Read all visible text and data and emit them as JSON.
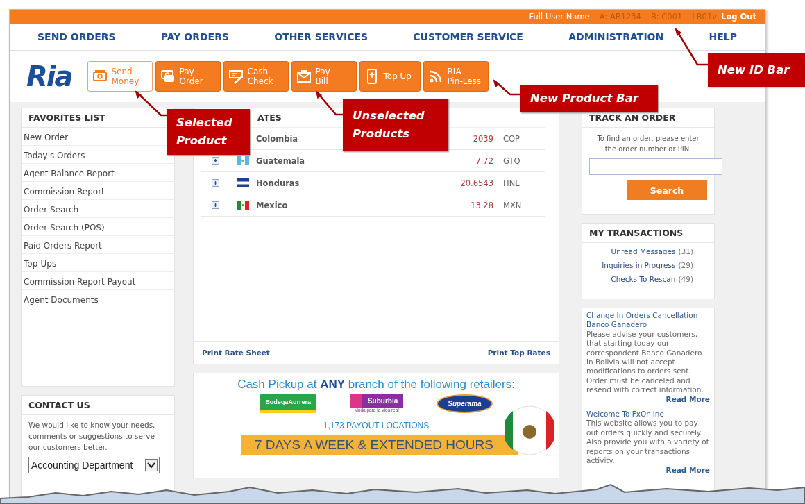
{
  "id_bar": {
    "user_name": "Full User Name",
    "ids": [
      "A: AB1234",
      "B: C001",
      "LB01v"
    ],
    "logout": "Log Out"
  },
  "nav": [
    "SEND ORDERS",
    "PAY ORDERS",
    "OTHER SERVICES",
    "CUSTOMER SERVICE",
    "ADMINISTRATION",
    "HELP"
  ],
  "logo": "Ria",
  "products": [
    {
      "lines": [
        "Send",
        "Money"
      ],
      "kind": "send",
      "selected": true
    },
    {
      "lines": [
        "Pay",
        "Order"
      ],
      "kind": "pay",
      "selected": false
    },
    {
      "lines": [
        "Cash",
        "Check"
      ],
      "kind": "check",
      "selected": false
    },
    {
      "lines": [
        "Pay",
        "Bill"
      ],
      "kind": "bill",
      "selected": false
    },
    {
      "lines": [
        "Top Up"
      ],
      "kind": "phone",
      "selected": false
    },
    {
      "lines": [
        "RIA",
        "Pin-Less"
      ],
      "kind": "signal",
      "selected": false
    }
  ],
  "favorites": {
    "title": "FAVORITES LIST",
    "items": [
      "New Order",
      "Today's Orders",
      "Agent Balance Report",
      "Commission Report",
      "Order Search",
      "Order Search (POS)",
      "Paid Orders Report",
      "Top-Ups",
      "Commission Report Payout",
      "Agent Documents"
    ]
  },
  "contact": {
    "title": "CONTACT US",
    "text": "We would like to know your needs, comments or suggestions to serve our customers better.",
    "select": "Accounting Department"
  },
  "rates": {
    "title": "ATES",
    "rows": [
      {
        "country": "Colombia",
        "rate": "2039",
        "currency": "COP",
        "kind": "covered"
      },
      {
        "country": "Guatemala",
        "rate": "7.72",
        "currency": "GTQ",
        "kind": "guatemala"
      },
      {
        "country": "Honduras",
        "rate": "20.6543",
        "currency": "HNL",
        "kind": "honduras"
      },
      {
        "country": "Mexico",
        "rate": "13.28",
        "currency": "MXN",
        "kind": "mexico"
      }
    ],
    "links": [
      "Print Rate Sheet",
      "Print Top Rates"
    ]
  },
  "banner": {
    "headline": "Cash Pickup at **ANY** branch of the following retailers:",
    "logos": [
      {
        "kind": "bodega",
        "text": "BodegaAurrera"
      },
      {
        "kind": "suburbia",
        "text": "Suburbia",
        "tagline": "Moda para la vida real"
      },
      {
        "kind": "superama",
        "text": "Superama"
      }
    ],
    "locations": "1,173 PAYOUT LOCATIONS",
    "hours": "7 DAYS A WEEK & EXTENDED HOURS"
  },
  "track": {
    "title": "TRACK AN ORDER",
    "text": "To find an order, please enter the order number or PIN.",
    "button": "Search"
  },
  "transactions": {
    "title": "MY TRANSACTIONS",
    "items": [
      {
        "label": "Unread Messages",
        "count": "(31)"
      },
      {
        "label": "Inquiries in Progress",
        "count": "(29)"
      },
      {
        "label": "Checks To Rescan",
        "count": "(49)"
      }
    ]
  },
  "news": [
    {
      "title": "Change In Orders Cancellation Banco Ganadero",
      "body": "Please advise your customers, that starting today our correspondent Banco Ganadero in Bolivia will not accept modifications to orders sent. Order must be canceled and resend with correct information.",
      "link": "Read More"
    },
    {
      "title": "Welcome To FxOnline",
      "body": "This website allows you to pay out orders quickly and securely. Also provide you with a variety of reports on your transactions activity.",
      "link": "Read More"
    }
  ],
  "callouts": [
    {
      "kind": "id",
      "text": "New ID Bar"
    },
    {
      "kind": "product_bar",
      "text": "New Product Bar"
    },
    {
      "kind": "unselected",
      "text": "Unselected Products"
    },
    {
      "kind": "selected",
      "text": "Selected Product"
    }
  ]
}
